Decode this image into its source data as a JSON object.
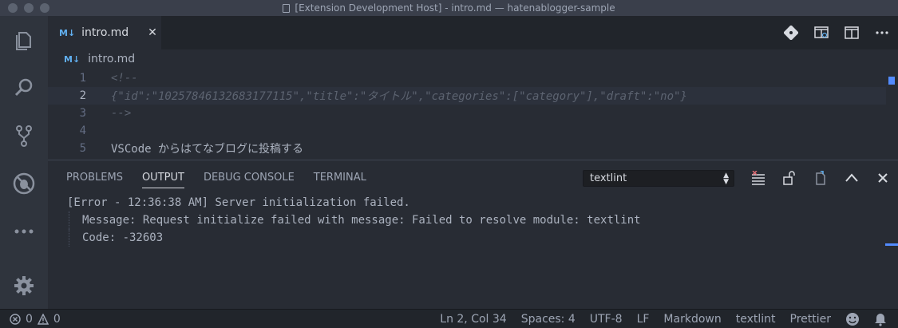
{
  "window": {
    "title": "[Extension Development Host] - intro.md — hatenablogger-sample"
  },
  "activity_bar": {
    "items": [
      {
        "icon": "files-icon"
      },
      {
        "icon": "search-icon"
      },
      {
        "icon": "source-control-icon"
      },
      {
        "icon": "debug-icon"
      },
      {
        "icon": "more-icon"
      },
      {
        "icon": "gear-icon"
      }
    ]
  },
  "tabs": [
    {
      "badge": "M↓",
      "label": "intro.md",
      "close": "✕"
    }
  ],
  "tab_actions": [
    "open-preview-icon",
    "open-preview-side-icon",
    "split-editor-icon",
    "more-actions-icon"
  ],
  "breadcrumb": {
    "badge": "M↓",
    "label": "intro.md"
  },
  "editor": {
    "active_line": 2,
    "lines": [
      {
        "number": "1",
        "text": "<!--",
        "style": "comment"
      },
      {
        "number": "2",
        "text": "{\"id\":\"10257846132683177115\",\"title\":\"タイトル\",\"categories\":[\"category\"],\"draft\":\"no\"}",
        "style": "comment"
      },
      {
        "number": "3",
        "text": "-->",
        "style": "comment"
      },
      {
        "number": "4",
        "text": "",
        "style": "plain"
      },
      {
        "number": "5",
        "text": "VSCode からはてなブログに投稿する",
        "style": "plain"
      }
    ]
  },
  "panel": {
    "tabs": [
      {
        "label": "PROBLEMS",
        "active": false
      },
      {
        "label": "OUTPUT",
        "active": true
      },
      {
        "label": "DEBUG CONSOLE",
        "active": false
      },
      {
        "label": "TERMINAL",
        "active": false
      }
    ],
    "channel_select": "textlint",
    "output_lines": [
      {
        "text": "[Error - 12:36:38 AM] Server initialization failed.",
        "indent": false
      },
      {
        "text": "Message: Request initialize failed with message: Failed to resolve module: textlint",
        "indent": true
      },
      {
        "text": "Code: -32603",
        "indent": true
      }
    ]
  },
  "status_bar": {
    "errors": "0",
    "warnings": "0",
    "position": "Ln 2, Col 34",
    "spaces": "Spaces: 4",
    "encoding": "UTF-8",
    "eol": "LF",
    "language": "Markdown",
    "linter": "textlint",
    "formatter": "Prettier"
  },
  "colors": {
    "accent": "#528bff",
    "markdown_badge": "#61afef",
    "comment": "#5c6370"
  }
}
